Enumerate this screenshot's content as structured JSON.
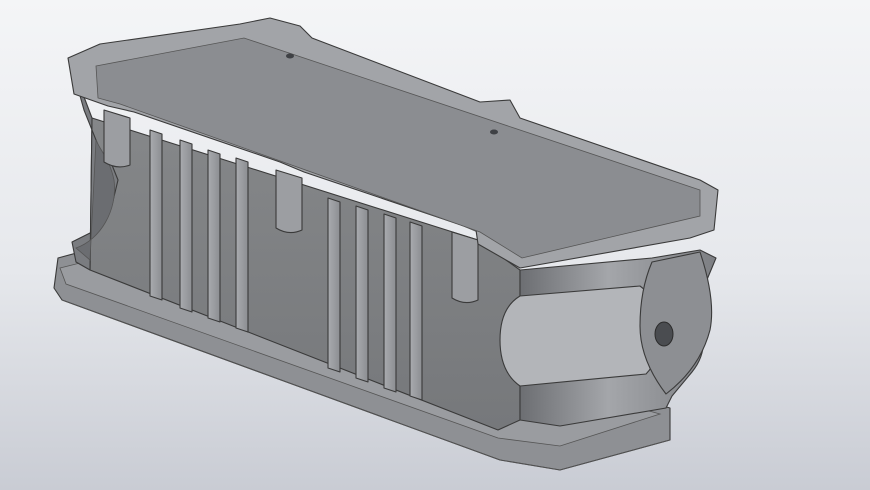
{
  "viewport": {
    "background_top": "#f4f5f7",
    "background_bottom": "#c9ccd4"
  },
  "model": {
    "body_color": "#8a8c90",
    "light_face": "#a6a8ac",
    "dark_face": "#6f7175",
    "edge_color": "#3a3a3a"
  }
}
